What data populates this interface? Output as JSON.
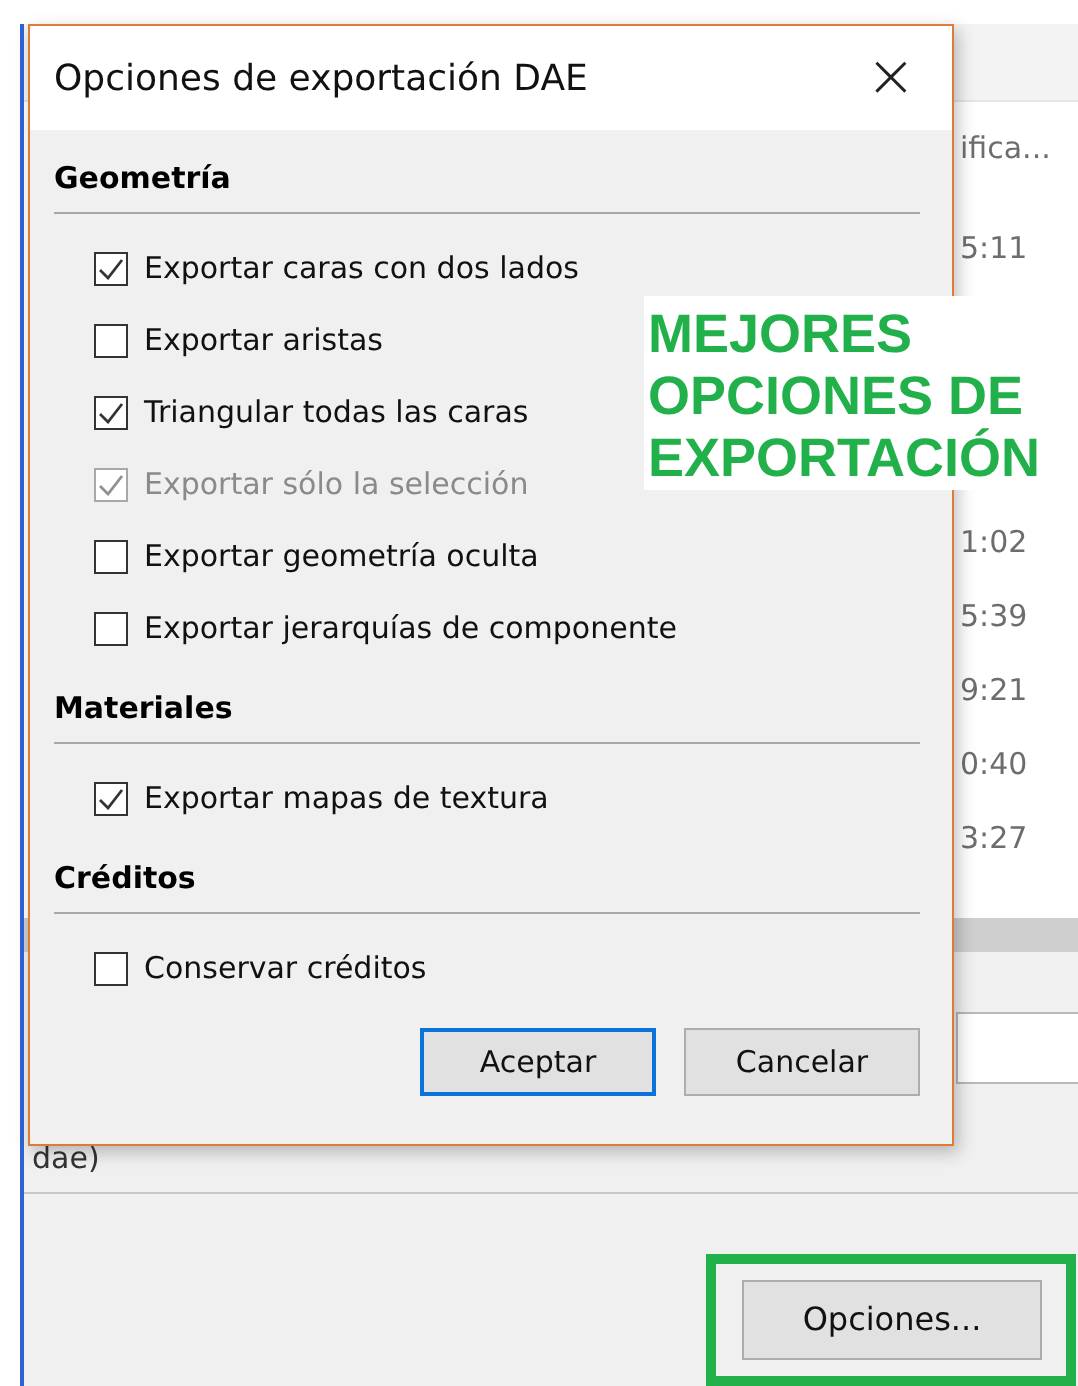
{
  "background_window": {
    "column_header": "ifica...",
    "times": [
      "5:11",
      "1:02",
      "5:39",
      "9:21",
      "0:40",
      "3:27"
    ],
    "file_type": "dae)",
    "options_button": "Opciones...",
    "options_highlighted": true
  },
  "dialog": {
    "title": "Opciones de exportación DAE",
    "close": "×",
    "sections": [
      {
        "heading": "Geometría",
        "options": [
          {
            "label": "Exportar caras con dos lados",
            "checked": true,
            "disabled": false
          },
          {
            "label": "Exportar aristas",
            "checked": false,
            "disabled": false
          },
          {
            "label": "Triangular todas las caras",
            "checked": true,
            "disabled": false
          },
          {
            "label": "Exportar sólo la selección",
            "checked": true,
            "disabled": true
          },
          {
            "label": "Exportar geometría oculta",
            "checked": false,
            "disabled": false
          },
          {
            "label": "Exportar jerarquías de componente",
            "checked": false,
            "disabled": false
          }
        ]
      },
      {
        "heading": "Materiales",
        "options": [
          {
            "label": "Exportar mapas de textura",
            "checked": true,
            "disabled": false
          }
        ]
      },
      {
        "heading": "Créditos",
        "options": [
          {
            "label": "Conservar créditos",
            "checked": false,
            "disabled": false
          }
        ]
      }
    ],
    "buttons": [
      {
        "label": "Aceptar",
        "default": true
      },
      {
        "label": "Cancelar",
        "default": false
      }
    ]
  },
  "annotation": "MEJORES\nOPCIONES DE\nEXPORTACIÓN"
}
